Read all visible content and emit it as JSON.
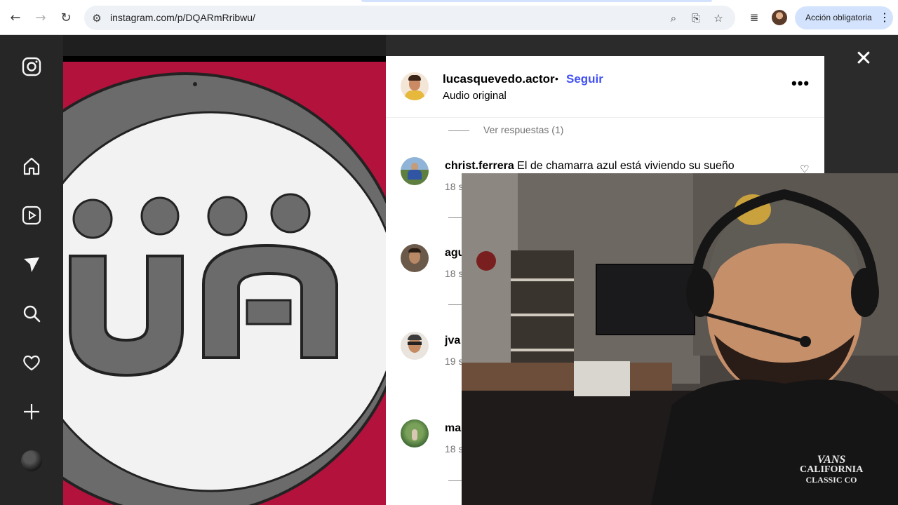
{
  "browser": {
    "url": "instagram.com/p/DQARmRribwu/",
    "action_button": "Acción obligatoria",
    "icons": [
      "back-icon",
      "forward-icon",
      "reload-icon",
      "site-settings-icon",
      "zoom-icon",
      "install-icon",
      "bookmark-star-icon",
      "media-controls-icon",
      "profile-avatar",
      "kebab-menu-icon"
    ]
  },
  "rail": {
    "icons": [
      "instagram-logo-icon",
      "home-icon",
      "reels-icon",
      "direct-messages-icon",
      "search-icon",
      "notifications-heart-icon",
      "create-plus-icon",
      "profile-avatar"
    ]
  },
  "post": {
    "author": "lucasquevedo.actor",
    "separator": "•",
    "follow": "Seguir",
    "audio": "Audio original",
    "more": "•••"
  },
  "comments": {
    "view_replies": "Ver respuestas (1)",
    "items": [
      {
        "user": "christ.ferrera",
        "text": "El de chamarra azul está viviendo su sueño",
        "time": "18 s"
      },
      {
        "user": "agu",
        "text": "",
        "time": "18 s"
      },
      {
        "user": "jva",
        "text": "",
        "time": "19 s"
      },
      {
        "user": "ma",
        "text": "",
        "time": "18 s"
      }
    ]
  },
  "media": {
    "logo_text": "ÜA",
    "background_color": "#b3123c"
  },
  "webcam": {
    "shirt_text_1": "VANS",
    "shirt_text_2": "CALIFORNIA",
    "shirt_text_3": "CLASSIC CO"
  },
  "close_icon": "✕"
}
